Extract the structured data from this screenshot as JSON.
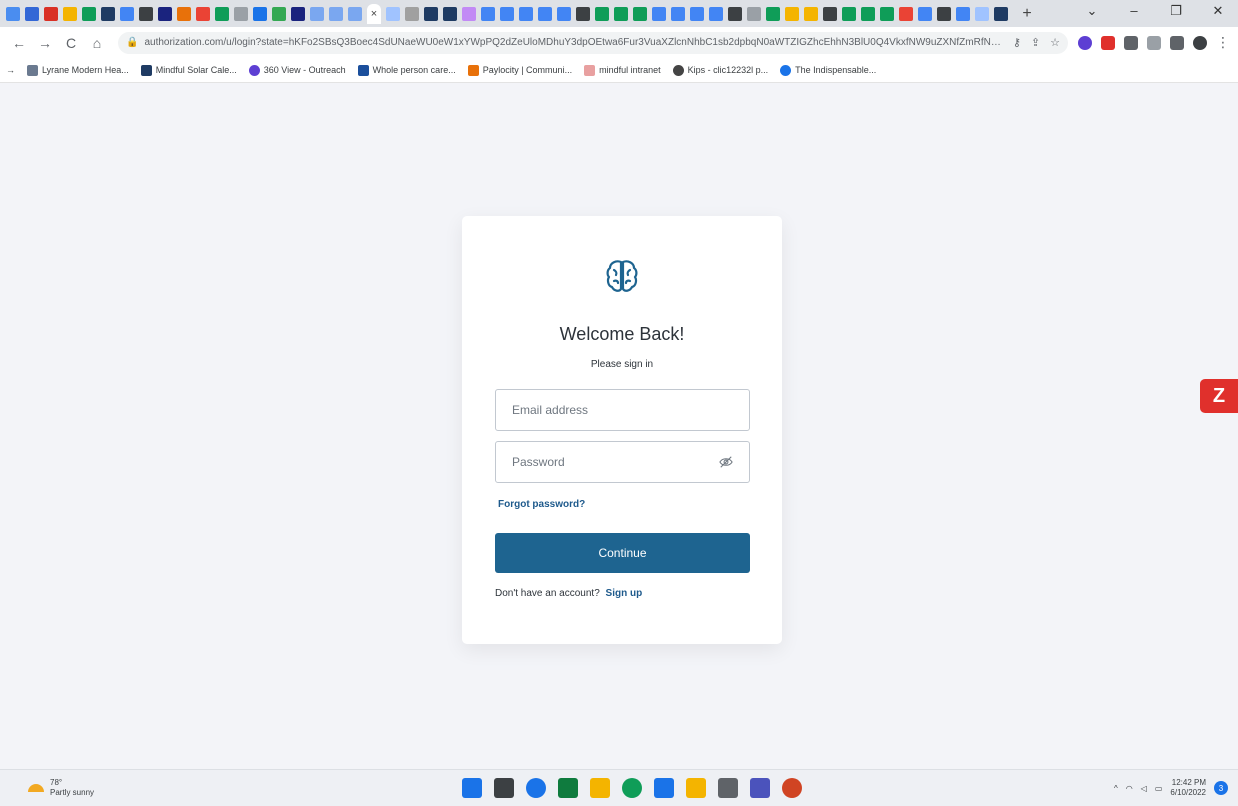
{
  "browser": {
    "url": "authorization.com/u/login?state=hKFo2SBsQ3Boec4SdUNaeWU0eW1xYWpPQ2dZeUloMDhuY3dpOEtwa6Fur3VuaXZlcnNhbC1sb2dpbqN0aWTZIGZhcEhhN3BlU0Q4VkxfNW9uZXNfZmRfNVBtOGpOTmFH",
    "lock_icon": "lock-icon",
    "tab_close": "×",
    "new_tab": "+",
    "window_controls": {
      "minimize": "–",
      "maximize": "❐",
      "close": "✕"
    },
    "nav": {
      "back": "←",
      "forward": "→",
      "reload": "C",
      "home": "⌂"
    },
    "omnibox_icons": [
      "key-icon",
      "share-icon",
      "star-icon"
    ],
    "star": "☆",
    "key": "⚷",
    "share": "⇪",
    "more_menu": "⋮",
    "bookmarks": [
      {
        "label": "Lyrane Modern Hea...",
        "color": "#6b7a90"
      },
      {
        "label": "Mindful Solar Cale...",
        "color": "#1f3b63"
      },
      {
        "label": "360 View - Outreach",
        "color": "#5d3fd3"
      },
      {
        "label": "Whole person care...",
        "color": "#1b4f9c"
      },
      {
        "label": "Paylocity | Communi...",
        "color": "#e8710a"
      },
      {
        "label": "mindful intranet",
        "color": "#e8a0a0"
      },
      {
        "label": "Kips - clic12232l p...",
        "color": "#444444"
      },
      {
        "label": "The Indispensable...",
        "color": "#1a73e8"
      }
    ],
    "bookmark_lead": "→"
  },
  "login": {
    "title": "Welcome Back!",
    "subtitle": "Please sign in",
    "email_placeholder": "Email address",
    "password_placeholder": "Password",
    "forgot_password": "Forgot password?",
    "continue_label": "Continue",
    "no_account_text": "Don't have an account?",
    "signup_label": "Sign up",
    "logo_icon": "brain-icon",
    "show_password_icon": "eye-icon"
  },
  "side_widget": {
    "label": "Z",
    "color": "#e0302c"
  },
  "taskbar": {
    "weather_temp": "78°",
    "weather_desc": "Partly sunny",
    "time": "12:42 PM",
    "date": "6/10/2022",
    "notification_count": "3"
  },
  "colors": {
    "accent": "#1e6490",
    "link": "#1e5a8c",
    "page_bg": "#f3f4f8"
  }
}
